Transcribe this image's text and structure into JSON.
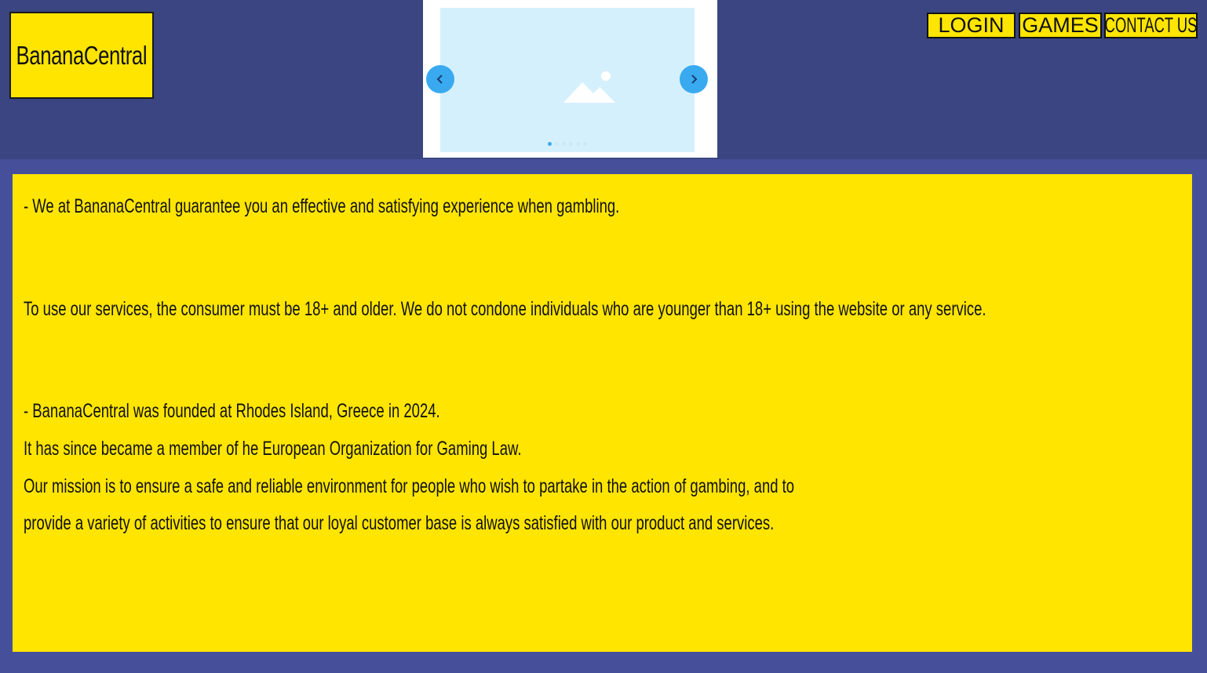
{
  "header": {
    "logo_text": "BananaCentral",
    "nav": {
      "login": "LOGIN",
      "games": "GAMES",
      "contact": "CONTACT US"
    },
    "carousel": {
      "slide_count": 6,
      "active_index": 0,
      "image_icon": "image-placeholder-icon",
      "prev_icon": "chevron-left-icon",
      "next_icon": "chevron-right-icon"
    }
  },
  "content": {
    "line1": "- We at BananaCentral guarantee you an effective and satisfying experience when gambling.",
    "line2": "To use our services, the consumer must be 18+ and older. We do not condone individuals who are younger than 18+ using the website or any service.",
    "line3": "- BananaCentral was founded at Rhodes Island, Greece in 2024.",
    "line4": " It has since became a member of he European Organization for Gaming Law.",
    "line5": "Our mission is to ensure a safe and reliable environment for people who wish to partake in the action of gambing, and to",
    "line6": "provide a variety of activities to ensure that our loyal customer base is always satisfied with our product and services."
  },
  "colors": {
    "header_bg": "#3a4581",
    "page_bg": "#46509a",
    "accent_yellow": "#ffe500",
    "carousel_arrow": "#39aaf0"
  }
}
